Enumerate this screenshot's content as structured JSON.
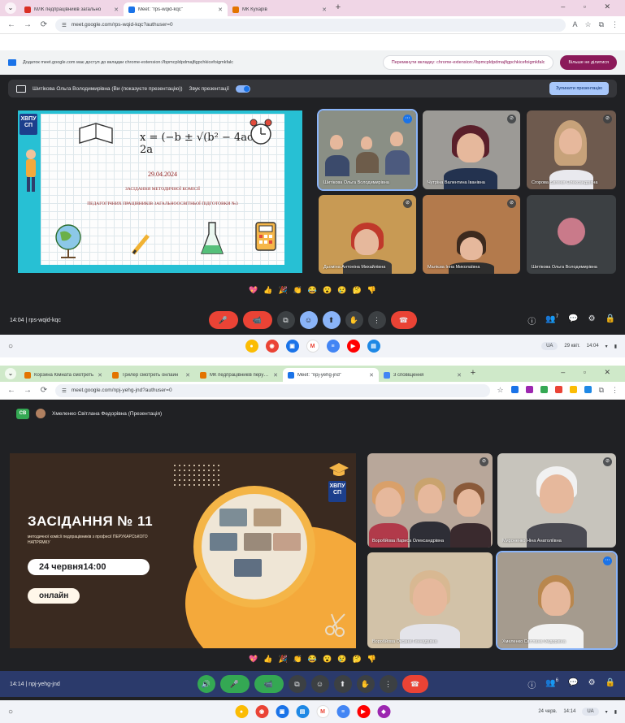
{
  "shot1": {
    "tabs": [
      {
        "title": "МЛК педпрацівників загально",
        "color": "#d93025",
        "active": false
      },
      {
        "title": "Meet: \"rps-wqid-kqc\"",
        "color": "#1a73e8",
        "active": true
      },
      {
        "title": "МК Кухарів",
        "color": "#e37400",
        "active": false
      }
    ],
    "url": "meet.google.com/rps-wqid-kqc?authuser=0",
    "infobar": {
      "text": "Додаток meet.google.com має доступ до вкладки chrome-extension://bpmcpldpdmajfigpchkicefoigmkfalc",
      "button_switch": "Перемкнути вкладку: chrome-extension://bpmcpldpdmajfigpchkicefoigmkfalc",
      "button_stop": "Більше не ділитися"
    },
    "presenter_bar": {
      "text": "Шитікова Ольга Володимирівна (Ви (показуєте презентацію))",
      "audio_label": "Звук презентації",
      "stop_button": "Зупинити презентацію"
    },
    "slide": {
      "logo": "ХВПУ СП",
      "formula": "x = (−b ± √(b² − 4ac)) / 2a",
      "date": "29.04.2024",
      "line1": "ЗАСІДАННЯ МЕТОДИЧНОЇ КОМІСІЇ",
      "line2": "ПЕДАГОГІЧНИХ ПРАЦІВНИКІВ ЗАГАЛЬНООСВІТНЬОЇ ПІДГОТОВКИ №3"
    },
    "participants": [
      {
        "name": "Шитікова Ольга Володимирівна",
        "active": true
      },
      {
        "name": "Чутріна Валентина Іванівна",
        "active": false
      },
      {
        "name": "Сгорова Євгенія Олександрівна",
        "active": false
      },
      {
        "name": "Дьоміна Антоніна Михайлівна",
        "active": false
      },
      {
        "name": "Малієва Інна Миколаївна",
        "active": false
      },
      {
        "name": "Шитікова Ольга Володимирівна",
        "active": false
      }
    ],
    "meeting_info": "14:04 | rps-wqid-kqc",
    "participants_count": "7",
    "taskbar": {
      "lang": "UA",
      "date": "29 квіт.",
      "time": "14:04"
    }
  },
  "shot2": {
    "tabs": [
      {
        "title": "Корзина Кімната смотреть",
        "color": "#e37400",
        "active": false
      },
      {
        "title": "Трилер смотреть онлайн",
        "color": "#e37400",
        "active": false
      },
      {
        "title": "МК педпрацівників перукар",
        "color": "#e37400",
        "active": false
      },
      {
        "title": "Meet: \"npj-yehg-jnd\"",
        "color": "#1a73e8",
        "active": true
      },
      {
        "title": "3 сповіщення",
        "color": "#4285f4",
        "active": false
      }
    ],
    "url": "meet.google.com/npj-yehg-jnd?authuser=0",
    "presenter_bar": {
      "badge": "СВ",
      "text": "Хмеленко Світлана Федорівна (Презентація)"
    },
    "slide": {
      "logo": "ХВПУ СП",
      "title": "ЗАСІДАННЯ № 11",
      "subtitle": "методичної комісії педпрацівників з професії ПЕРУКАРСЬКОГО НАПРЯМКУ",
      "date_pill": "24 червня14:00",
      "online_pill": "онлайн"
    },
    "participants": [
      {
        "name": "Воробйова Лариса Олександрівна",
        "active": false
      },
      {
        "name": "Мироненко Ніна Анатоліївна",
        "active": false
      },
      {
        "name": "Воробйова Оксана Геннадіївна",
        "active": false
      },
      {
        "name": "Хмеленко Світлана Федорівна",
        "active": true
      }
    ],
    "meeting_info": "14:14 | npj-yehg-jnd",
    "participants_count": "6",
    "taskbar": {
      "lang": "UA",
      "date": "24 черв.",
      "time": "14:14"
    }
  },
  "reactions": [
    "💖",
    "👍",
    "🎉",
    "👏",
    "😂",
    "😮",
    "😢",
    "🤔",
    "👎"
  ],
  "icons": {
    "back": "←",
    "forward": "→",
    "reload": "⟳",
    "more": "⋮",
    "mic": "🎤",
    "cam": "📹",
    "captions": "⧉",
    "emoji": "☺",
    "present": "⬆",
    "hand": "✋",
    "end": "☎",
    "info": "ⓘ",
    "people": "👥",
    "chat": "💬",
    "activities": "⚙",
    "lock": "🔒"
  }
}
